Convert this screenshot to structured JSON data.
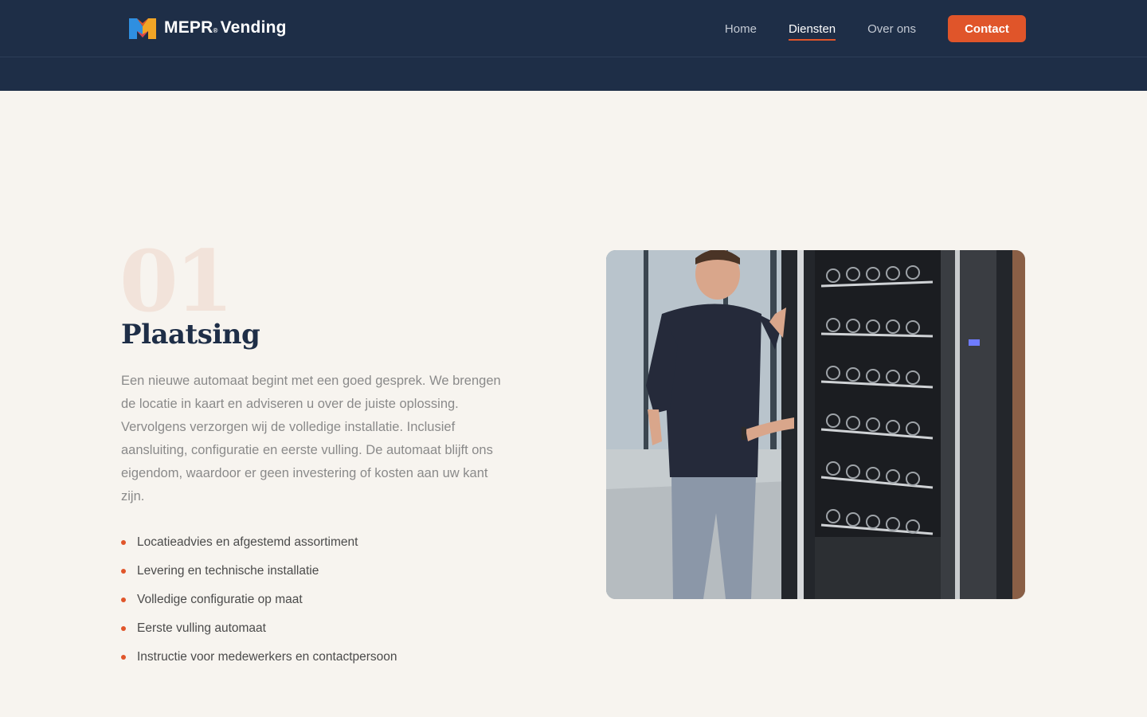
{
  "header": {
    "logo_text": "MEPR",
    "logo_suffix": "Vending",
    "logo_reg": "®",
    "nav": [
      {
        "label": "Home",
        "active": false
      },
      {
        "label": "Diensten",
        "active": true
      },
      {
        "label": "Over ons",
        "active": false
      }
    ],
    "contact_label": "Contact"
  },
  "section": {
    "number": "01",
    "title": "Plaatsing",
    "description": "Een nieuwe automaat begint met een goed gesprek. We brengen de locatie in kaart en adviseren u over de juiste oplossing. Vervolgens verzorgen wij de volledige installatie. Inclusief aansluiting, configuratie en eerste vulling. De automaat blijft ons eigendom, waardoor er geen investering of kosten aan uw kant zijn.",
    "features": [
      "Locatieadvies en afgestemd assortiment",
      "Levering en technische installatie",
      "Volledige configuratie op maat",
      "Eerste vulling automaat",
      "Instructie voor medewerkers en contactpersoon"
    ],
    "image_icon": "vending-machine-photo"
  },
  "colors": {
    "navy": "#1e2e47",
    "accent": "#e0552a",
    "background": "#f7f4ef"
  }
}
